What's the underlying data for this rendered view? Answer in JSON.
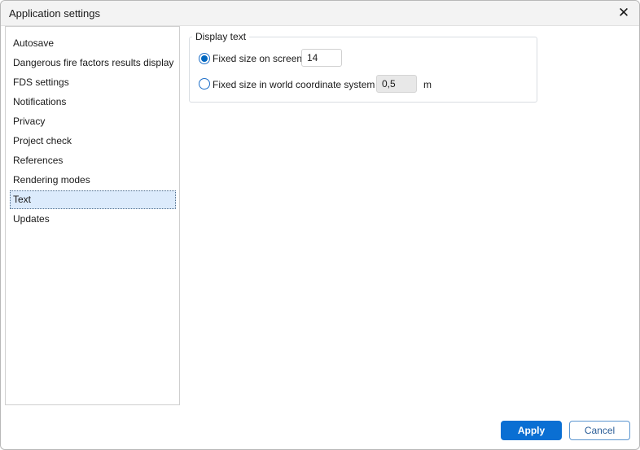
{
  "window": {
    "title": "Application settings",
    "close_icon": "close-icon"
  },
  "sidebar": {
    "items": [
      {
        "label": "Autosave"
      },
      {
        "label": "Dangerous fire factors results display"
      },
      {
        "label": "FDS settings"
      },
      {
        "label": "Notifications"
      },
      {
        "label": "Privacy"
      },
      {
        "label": "Project check"
      },
      {
        "label": "References"
      },
      {
        "label": "Rendering modes"
      },
      {
        "label": "Text",
        "selected": true
      },
      {
        "label": "Updates"
      }
    ]
  },
  "display_text": {
    "legend": "Display text",
    "option_screen": {
      "label": "Fixed size on screen",
      "value": "14",
      "selected": true
    },
    "option_world": {
      "label": "Fixed size in world coordinate system",
      "value": "0,5",
      "unit": "m",
      "selected": false
    }
  },
  "footer": {
    "apply_label": "Apply",
    "cancel_label": "Cancel"
  },
  "colors": {
    "accent": "#0a6fd3",
    "selection": "#dcebfc"
  }
}
